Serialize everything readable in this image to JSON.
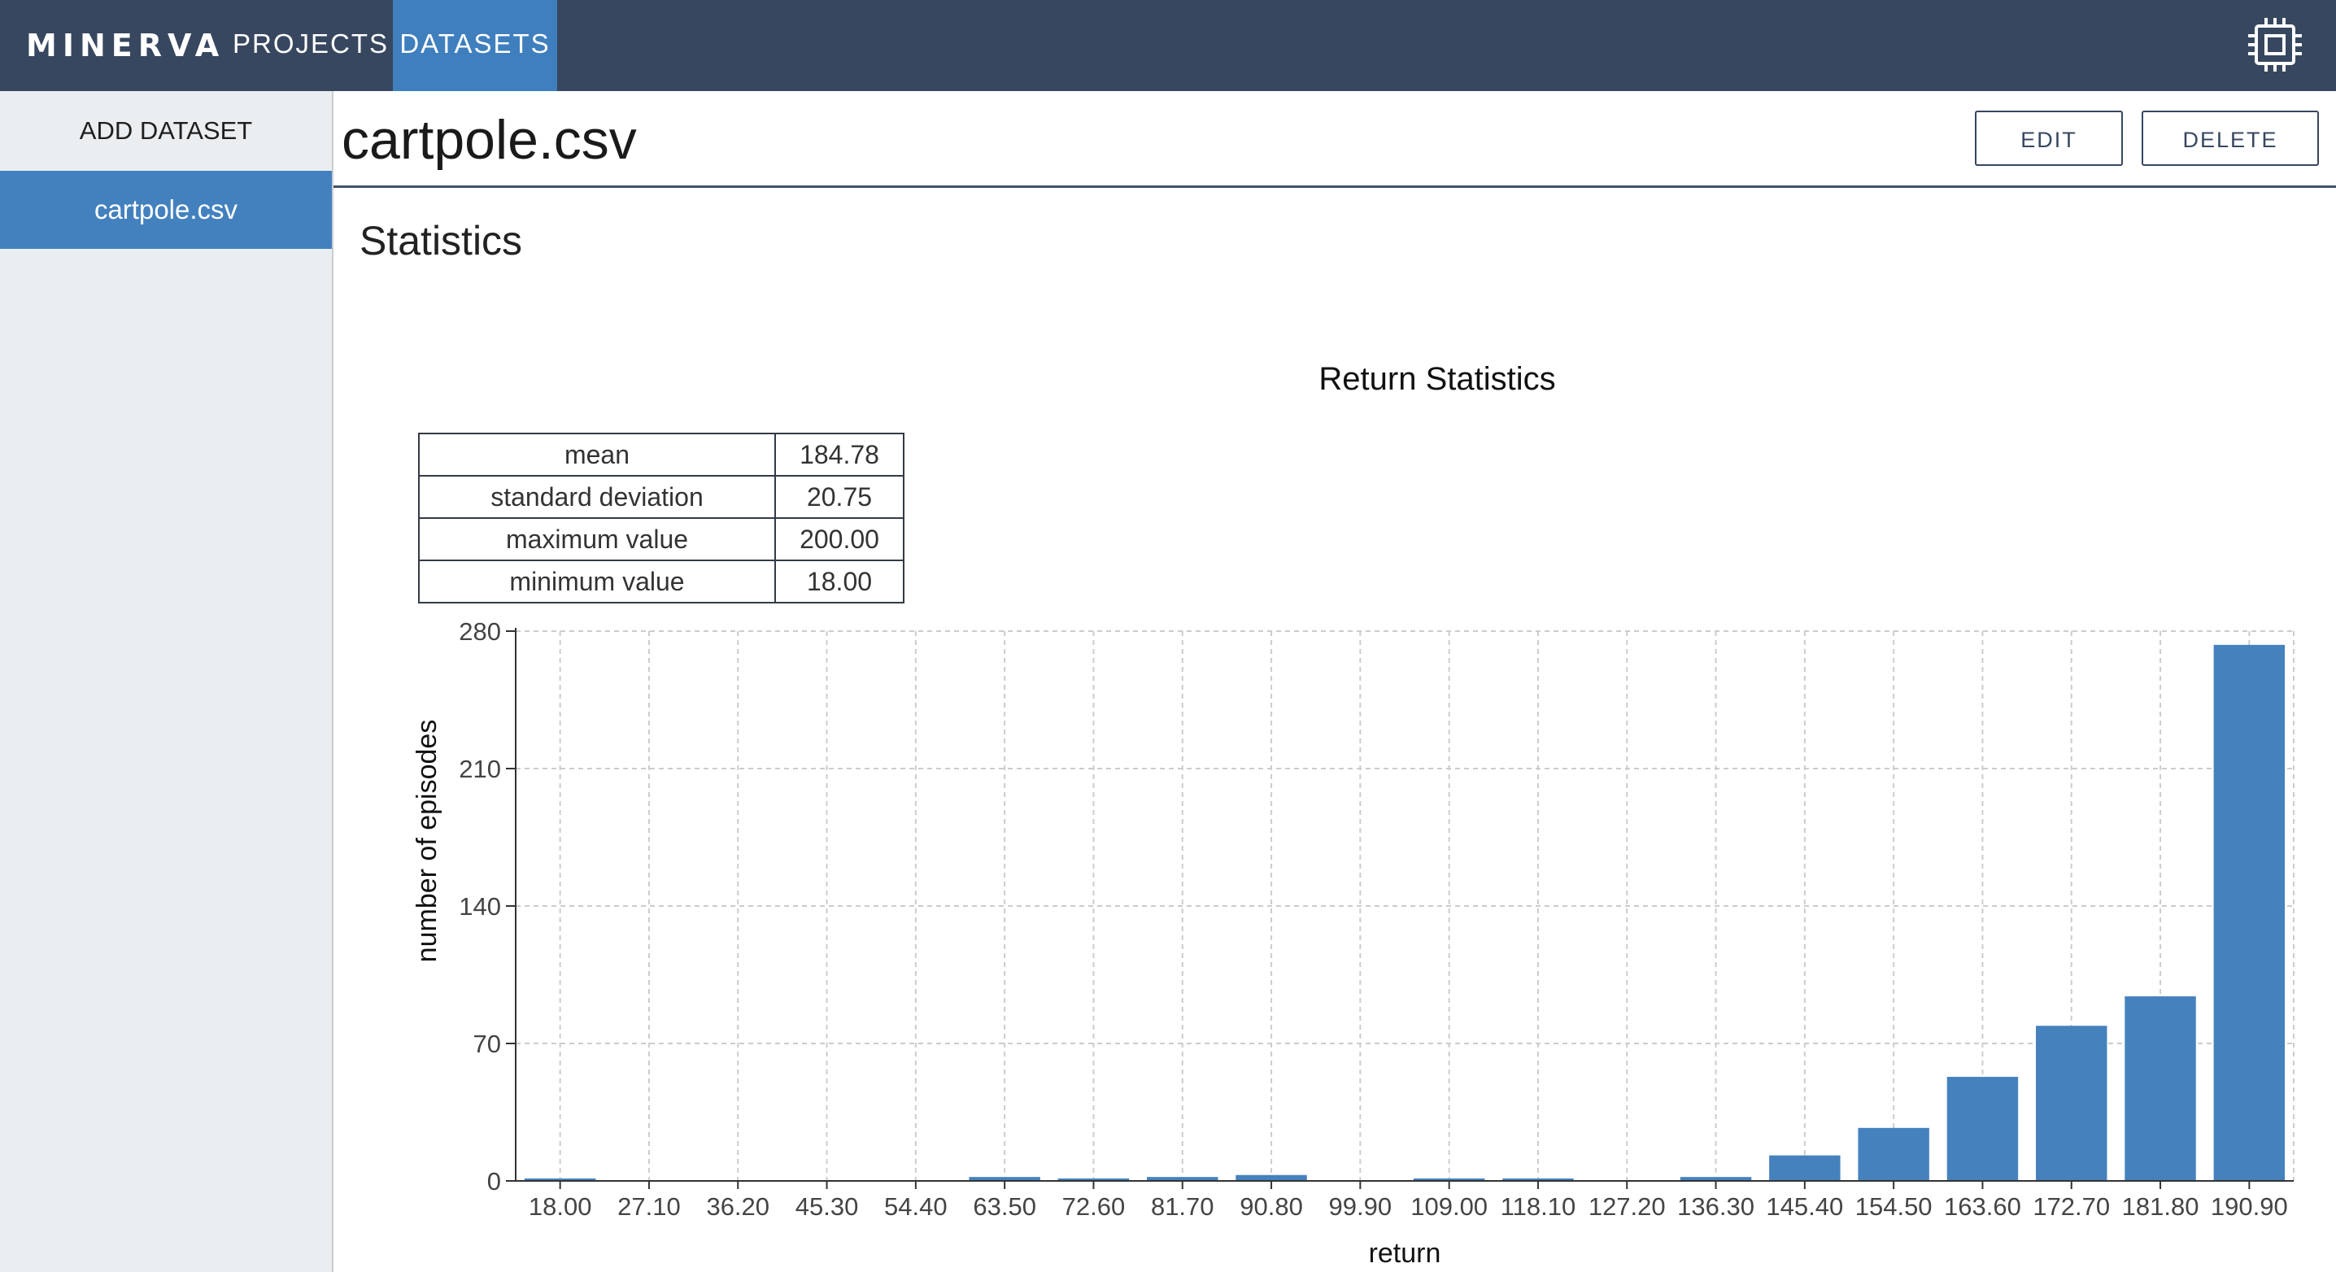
{
  "nav": {
    "brand": "MINERVA",
    "tabs": [
      {
        "label": "PROJECTS",
        "active": false
      },
      {
        "label": "DATASETS",
        "active": true
      }
    ],
    "settings_icon": "cpu-chip-icon"
  },
  "sidebar": {
    "add_label": "ADD DATASET",
    "items": [
      {
        "label": "cartpole.csv",
        "selected": true
      }
    ]
  },
  "header": {
    "title": "cartpole.csv",
    "edit_label": "EDIT",
    "delete_label": "DELETE"
  },
  "section": {
    "title": "Statistics"
  },
  "stats": {
    "rows": [
      {
        "label": "mean",
        "value": "184.78"
      },
      {
        "label": "standard deviation",
        "value": "20.75"
      },
      {
        "label": "maximum value",
        "value": "200.00"
      },
      {
        "label": "minimum value",
        "value": "18.00"
      }
    ]
  },
  "colors": {
    "nav_bg": "#37475f",
    "accent": "#3f7fbd",
    "bar": "#4582bd",
    "sidebar_bg": "#ebeef0"
  },
  "chart_data": {
    "type": "bar",
    "title": "Return Statistics",
    "xlabel": "return",
    "ylabel": "number of episodes",
    "categories": [
      "18.00",
      "27.10",
      "36.20",
      "45.30",
      "54.40",
      "63.50",
      "72.60",
      "81.70",
      "90.80",
      "99.90",
      "109.00",
      "118.10",
      "127.20",
      "136.30",
      "145.40",
      "154.50",
      "163.60",
      "172.70",
      "181.80",
      "190.90"
    ],
    "values": [
      1,
      0,
      0,
      0,
      0,
      2,
      1,
      2,
      3,
      0,
      1,
      1,
      0,
      2,
      13,
      27,
      53,
      79,
      94,
      273
    ],
    "ylim": [
      0,
      280
    ],
    "yticks": [
      0,
      70,
      140,
      210,
      280
    ],
    "grid": true,
    "legend": "none"
  }
}
